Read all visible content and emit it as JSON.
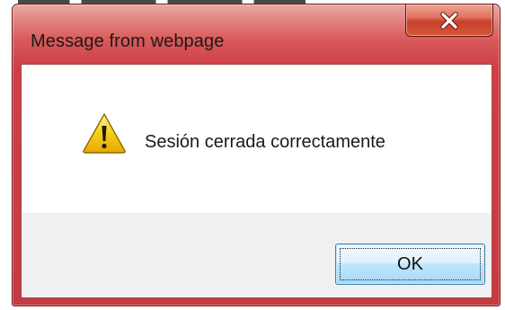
{
  "dialog": {
    "title": "Message from webpage",
    "message": "Sesión cerrada correctamente",
    "ok_label": "OK",
    "icons": {
      "close": "close-icon",
      "message": "warning-icon"
    },
    "colors": {
      "frame": "#d9595a",
      "close_button": "#c7402a",
      "button_area": "#f0f0f0",
      "ok_button_border": "#3c7fb1",
      "warning_fill": "#f5c400"
    }
  }
}
